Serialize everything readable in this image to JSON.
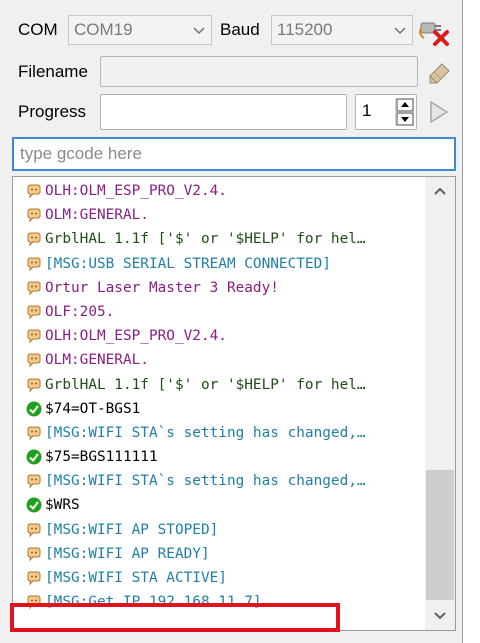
{
  "toolbar": {
    "com_label": "COM",
    "com_value": "COM19",
    "baud_label": "Baud",
    "baud_value": "115200",
    "disconnect_icon": "plug-disconnect-icon"
  },
  "file_row": {
    "filename_label": "Filename",
    "filename_value": "",
    "browse_icon": "eraser-icon"
  },
  "progress_row": {
    "progress_label": "Progress",
    "progress_fraction": 0,
    "count_value": "1",
    "send_icon": "play-icon"
  },
  "gcode_input": {
    "placeholder": "type gcode here",
    "value": ""
  },
  "console": {
    "lines": [
      {
        "text": "OLH:OLM_ESP_PRO_V2.4.",
        "color": "#8a1e86",
        "icon": "message-icon"
      },
      {
        "text": "OLM:GENERAL.",
        "color": "#8a1e86",
        "icon": "message-icon"
      },
      {
        "text": "GrblHAL 1.1f ['$' or '$HELP' for hel…",
        "color": "#1f4e16",
        "icon": "message-icon"
      },
      {
        "text": "[MSG:USB SERIAL STREAM CONNECTED]",
        "color": "#1f7fa6",
        "icon": "message-icon"
      },
      {
        "text": "Ortur Laser Master 3 Ready!",
        "color": "#8a1e86",
        "icon": "message-icon"
      },
      {
        "text": "OLF:205.",
        "color": "#8a1e86",
        "icon": "message-icon"
      },
      {
        "text": "OLH:OLM_ESP_PRO_V2.4.",
        "color": "#8a1e86",
        "icon": "message-icon"
      },
      {
        "text": "OLM:GENERAL.",
        "color": "#8a1e86",
        "icon": "message-icon"
      },
      {
        "text": "GrblHAL 1.1f ['$' or '$HELP' for hel…",
        "color": "#1f4e16",
        "icon": "message-icon"
      },
      {
        "text": "$74=OT-BGS1",
        "color": "#000000",
        "icon": "check-icon"
      },
      {
        "text": "[MSG:WIFI STA`s setting has changed,…",
        "color": "#1f7fa6",
        "icon": "message-icon"
      },
      {
        "text": "$75=BGS111111",
        "color": "#000000",
        "icon": "check-icon"
      },
      {
        "text": "[MSG:WIFI STA`s setting has changed,…",
        "color": "#1f7fa6",
        "icon": "message-icon"
      },
      {
        "text": "$WRS",
        "color": "#000000",
        "icon": "check-icon"
      },
      {
        "text": "[MSG:WIFI AP STOPED]",
        "color": "#1f7fa6",
        "icon": "message-icon"
      },
      {
        "text": "[MSG:WIFI AP READY]",
        "color": "#1f7fa6",
        "icon": "message-icon"
      },
      {
        "text": "[MSG:WIFI STA ACTIVE]",
        "color": "#1f7fa6",
        "icon": "message-icon"
      },
      {
        "text": "[MSG:Get IP 192.168.11.7]",
        "color": "#1f7fa6",
        "icon": "message-icon",
        "highlighted": true
      }
    ],
    "highlight_color": "#e0141e"
  },
  "colors": {
    "accent_focus": "#3c8ad3",
    "purple": "#8a1e86",
    "green": "#1f4e16",
    "blue": "#1f7fa6"
  }
}
